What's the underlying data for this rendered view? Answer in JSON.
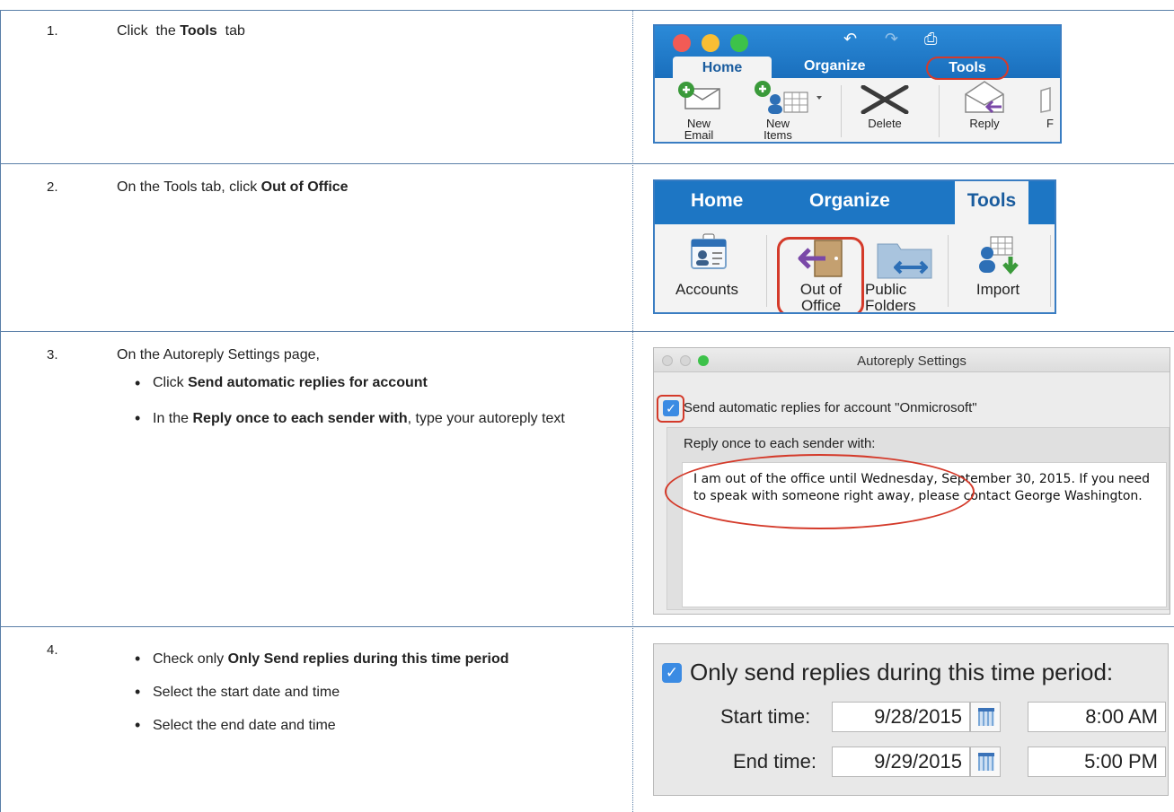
{
  "steps": [
    {
      "num": "1.",
      "text_prefix": "Click  the ",
      "text_bold": "Tools",
      "text_suffix": "  tab"
    },
    {
      "num": "2.",
      "text_prefix": "On the Tools tab, click ",
      "text_bold": "Out of Office",
      "text_suffix": ""
    },
    {
      "num": "3.",
      "intro": "On the Autoreply Settings page,",
      "bullets": [
        {
          "bold_prefix": "",
          "plain_prefix": "Click ",
          "bold": "Send automatic replies for account",
          "suffix": ""
        },
        {
          "bold_prefix": "",
          "plain_prefix": "In the ",
          "bold": "Reply once to each sender with",
          "suffix": ", type your autoreply text"
        }
      ]
    },
    {
      "num": "4.",
      "bullets": [
        {
          "plain_prefix": "Check only ",
          "bold": "Only Send replies during this time period",
          "suffix": ""
        },
        {
          "plain_prefix": "Select the start date and time",
          "bold": "",
          "suffix": ""
        },
        {
          "plain_prefix": "Select the end date and time",
          "bold": "",
          "suffix": ""
        }
      ]
    }
  ],
  "panel1": {
    "tabs": [
      "Home",
      "Organize",
      "Tools"
    ],
    "buttons": [
      {
        "label": "New\nEmail",
        "icon": "new-email-icon"
      },
      {
        "label": "New\nItems",
        "icon": "new-items-icon"
      },
      {
        "label": "Delete",
        "icon": "delete-icon"
      },
      {
        "label": "Reply",
        "icon": "reply-icon"
      },
      {
        "label": "F",
        "icon": "forward-icon"
      }
    ]
  },
  "panel2": {
    "tabs": [
      "Home",
      "Organize",
      "Tools"
    ],
    "buttons": [
      {
        "label": "Accounts",
        "icon": "accounts-icon"
      },
      {
        "label": "Out of\nOffice",
        "icon": "out-of-office-icon"
      },
      {
        "label": "Public\nFolders",
        "icon": "public-folders-icon"
      },
      {
        "label": "Import",
        "icon": "import-icon"
      }
    ]
  },
  "panel3": {
    "window_title": "Autoreply Settings",
    "checkbox_label": "Send automatic replies for account \"Onmicrosoft\"",
    "reply_label": "Reply once to each sender with:",
    "reply_text": "I am out of the office until Wednesday, September 30, 2015. If you need to speak with someone right away, please contact George Washington."
  },
  "panel4": {
    "checkbox_label": "Only send replies during this time period:",
    "start_label": "Start time:",
    "start_date": "9/28/2015",
    "start_time": "8:00 AM",
    "end_label": "End time:",
    "end_date": "9/29/2015",
    "end_time": "5:00 PM"
  },
  "colors": {
    "ribbon_blue": "#1d76c4",
    "highlight_red": "#d43a2a",
    "checkbox_blue": "#3b8be3"
  }
}
